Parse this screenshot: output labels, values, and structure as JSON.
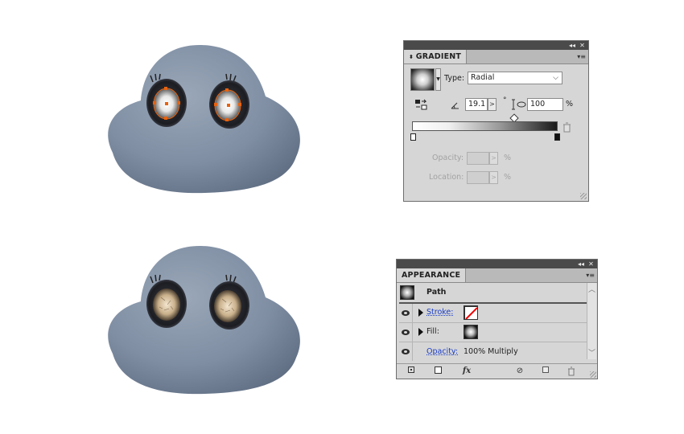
{
  "gradient_panel": {
    "tab_label": "GRADIENT",
    "type_label": "Type:",
    "type_value": "Radial",
    "angle_value": "19.1",
    "degree_symbol": "°",
    "aspect_value": "100",
    "percent_symbol": "%",
    "opacity_label": "Opacity:",
    "location_label": "Location:",
    "collapse_glyph": "◂◂",
    "close_glyph": "✕",
    "menu_glyph": "▾≡"
  },
  "appearance_panel": {
    "tab_label": "APPEARANCE",
    "object_label": "Path",
    "stroke_label": "Stroke:",
    "fill_label": "Fill:",
    "opacity_label": "Opacity:",
    "opacity_value": "100% Multiply",
    "collapse_glyph": "◂◂",
    "close_glyph": "✕",
    "menu_glyph": "▾≡",
    "scroll_up_glyph": "︿",
    "scroll_down_glyph": "﹀",
    "fx_label": "fx"
  },
  "colors": {
    "character_body": "#7c8ba0",
    "selection_orange": "#e8620f",
    "link_blue": "#1a3cc6"
  },
  "icons": [
    "collapse-icon",
    "close-icon",
    "panel-menu-icon",
    "reverse-gradient-icon",
    "angle-icon",
    "aspect-ratio-icon",
    "delete-stop-icon",
    "eye-icon",
    "expand-triangle-icon",
    "add-new-stroke-icon",
    "add-new-fill-icon",
    "fx-icon",
    "clear-appearance-icon",
    "duplicate-item-icon",
    "delete-item-icon"
  ]
}
